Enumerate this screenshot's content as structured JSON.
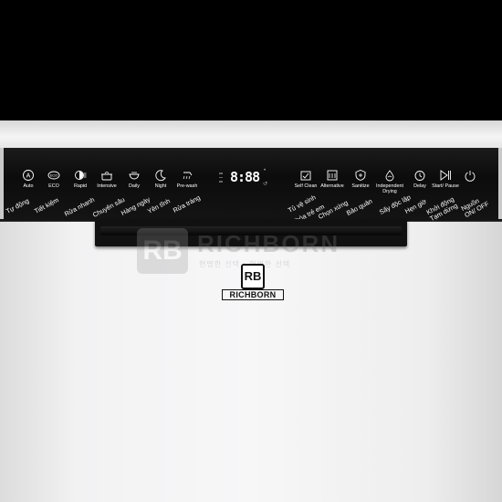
{
  "brand": {
    "name": "RICHBORN",
    "logo_letters": "RB"
  },
  "watermark": {
    "name": "RICHBORN",
    "sub": "현명한 선택 • 현명한 선택"
  },
  "display": {
    "digits": "8:88"
  },
  "buttons_left": [
    {
      "label": "Auto",
      "icon": "auto-icon"
    },
    {
      "label": "ECO",
      "icon": "eco-icon"
    },
    {
      "label": "Rapid",
      "icon": "rapid-icon"
    },
    {
      "label": "Intensive",
      "icon": "intensive-pot-icon"
    },
    {
      "label": "Daily",
      "icon": "daily-bowl-icon"
    },
    {
      "label": "Night",
      "icon": "night-moon-icon"
    },
    {
      "label": "Pre-wash",
      "icon": "prewash-icon"
    }
  ],
  "buttons_right": [
    {
      "label": "Self Clean",
      "icon": "self-clean-icon"
    },
    {
      "label": "Alternative",
      "icon": "alternative-icon"
    },
    {
      "label": "Sanitize",
      "icon": "sanitize-shield-icon"
    },
    {
      "label": "Independent Drying",
      "icon": "drying-icon"
    },
    {
      "label": "Delay",
      "icon": "delay-clock-icon"
    },
    {
      "label": "Start/ Pause",
      "icon": "start-pause-icon"
    },
    {
      "label": "",
      "icon": "power-icon"
    }
  ],
  "vi_left": [
    "Tự động",
    "Tiết kiệm",
    "Rửa nhanh",
    "Chuyên sâu",
    "Hàng ngày",
    "Yên tĩnh",
    "Rửa tráng"
  ],
  "vi_right": [
    "Tủ vệ sinh",
    "Khóa trẻ em",
    "Chọn xứng",
    "Bảo quản",
    "Sấy độc lập",
    "Hẹn giờ",
    "Khởi động Tạm dừng",
    "Nguồn ON/ OFF"
  ]
}
